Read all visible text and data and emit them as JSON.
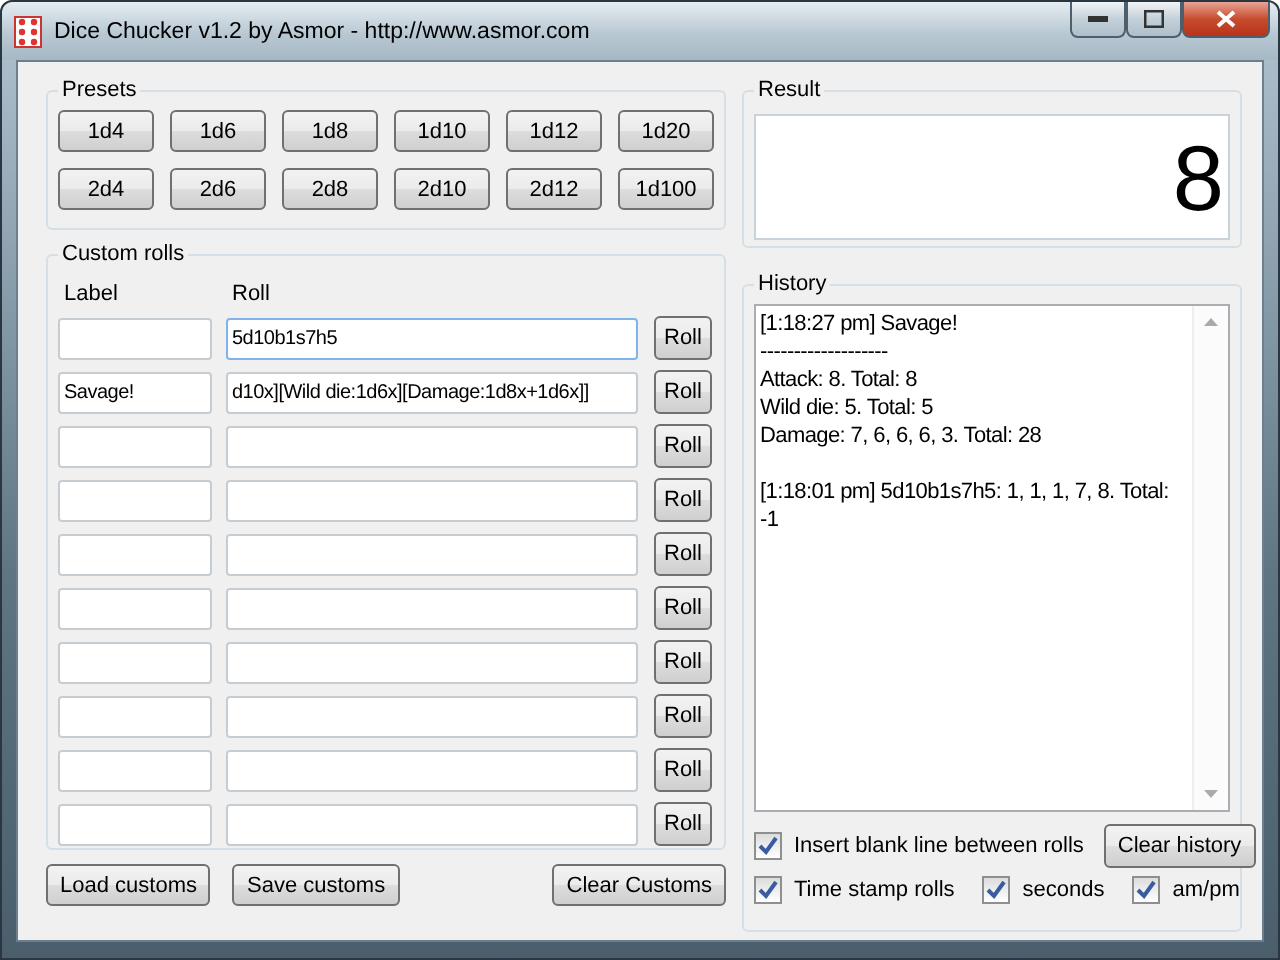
{
  "window": {
    "title": "Dice Chucker v1.2 by Asmor - http://www.asmor.com"
  },
  "presets": {
    "title": "Presets",
    "rows": [
      [
        "1d4",
        "1d6",
        "1d8",
        "1d10",
        "1d12",
        "1d20"
      ],
      [
        "2d4",
        "2d6",
        "2d8",
        "2d10",
        "2d12",
        "1d100"
      ]
    ]
  },
  "result": {
    "title": "Result",
    "value": "8"
  },
  "custom_rolls": {
    "title": "Custom rolls",
    "label_header": "Label",
    "roll_header": "Roll",
    "rows": [
      {
        "label": "",
        "roll": "5d10b1s7h5",
        "focused": true,
        "button": "Roll"
      },
      {
        "label": "Savage!",
        "roll": "d10x][Wild die:1d6x][Damage:1d8x+1d6x]]",
        "focused": false,
        "button": "Roll"
      },
      {
        "label": "",
        "roll": "",
        "focused": false,
        "button": "Roll"
      },
      {
        "label": "",
        "roll": "",
        "focused": false,
        "button": "Roll"
      },
      {
        "label": "",
        "roll": "",
        "focused": false,
        "button": "Roll"
      },
      {
        "label": "",
        "roll": "",
        "focused": false,
        "button": "Roll"
      },
      {
        "label": "",
        "roll": "",
        "focused": false,
        "button": "Roll"
      },
      {
        "label": "",
        "roll": "",
        "focused": false,
        "button": "Roll"
      },
      {
        "label": "",
        "roll": "",
        "focused": false,
        "button": "Roll"
      },
      {
        "label": "",
        "roll": "",
        "focused": false,
        "button": "Roll"
      }
    ]
  },
  "custom_buttons": [
    "Load customs",
    "Save customs",
    "Clear Customs"
  ],
  "history": {
    "title": "History",
    "entries": [
      {
        "lines": [
          "[1:18:27 pm] Savage!",
          "-------------------",
          "Attack: 8. Total: 8",
          "Wild die: 5. Total: 5",
          "Damage: 7, 6, 6, 6, 3. Total: 28"
        ]
      },
      {
        "lines": [
          "[1:18:01 pm] 5d10b1s7h5: 1, 1, 1, 7, 8. Total:",
          "-1"
        ]
      }
    ],
    "clear_button": "Clear history"
  },
  "options": [
    {
      "label": "Insert blank line between rolls",
      "checked": true
    },
    {
      "label": "Time stamp rolls",
      "checked": true
    },
    {
      "label": "seconds",
      "checked": true
    },
    {
      "label": "am/pm",
      "checked": true
    }
  ]
}
